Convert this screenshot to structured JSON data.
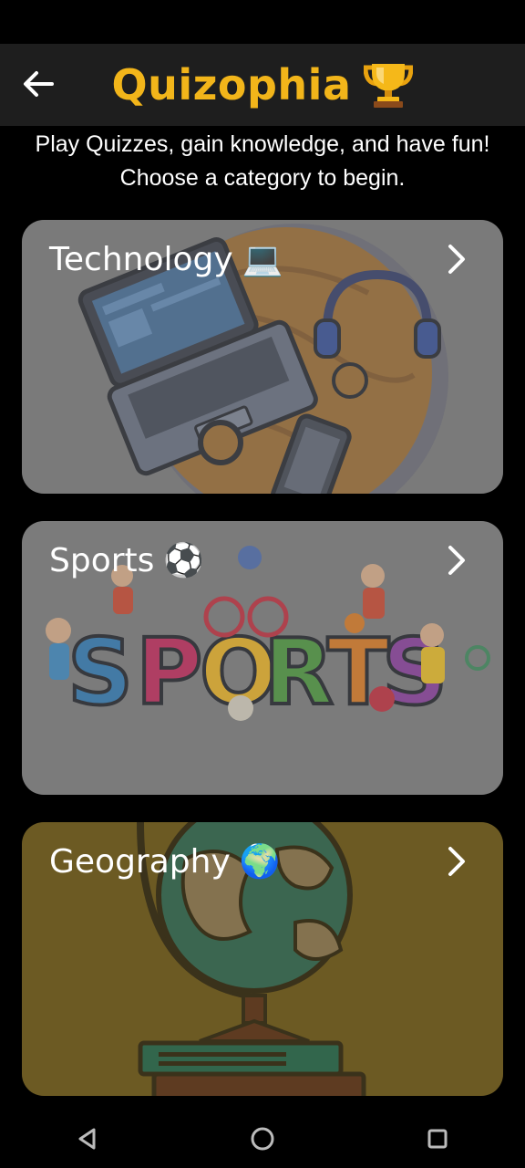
{
  "app": {
    "title": "Quizophia",
    "title_icon": "trophy-icon",
    "back_icon": "back-arrow-icon"
  },
  "intro": {
    "line1": "Play Quizzes, gain knowledge, and have fun!",
    "line2": "Choose a category to begin."
  },
  "categories": [
    {
      "label": "Technology",
      "emoji": "💻",
      "image": "laptop-headphones-phone-illustration",
      "background": "#7a7a7a"
    },
    {
      "label": "Sports",
      "emoji": "⚽",
      "image": "sports-kids-illustration",
      "background": "#7b7b7b"
    },
    {
      "label": "Geography",
      "emoji": "🌍",
      "image": "globe-on-books-illustration",
      "background": "#6d5a23"
    }
  ],
  "nav": {
    "back_icon": "nav-back-icon",
    "home_icon": "nav-home-icon",
    "recents_icon": "nav-recents-icon"
  },
  "colors": {
    "accent": "#f2b51a",
    "app_bar": "#1e1e1e",
    "background": "#000000"
  }
}
